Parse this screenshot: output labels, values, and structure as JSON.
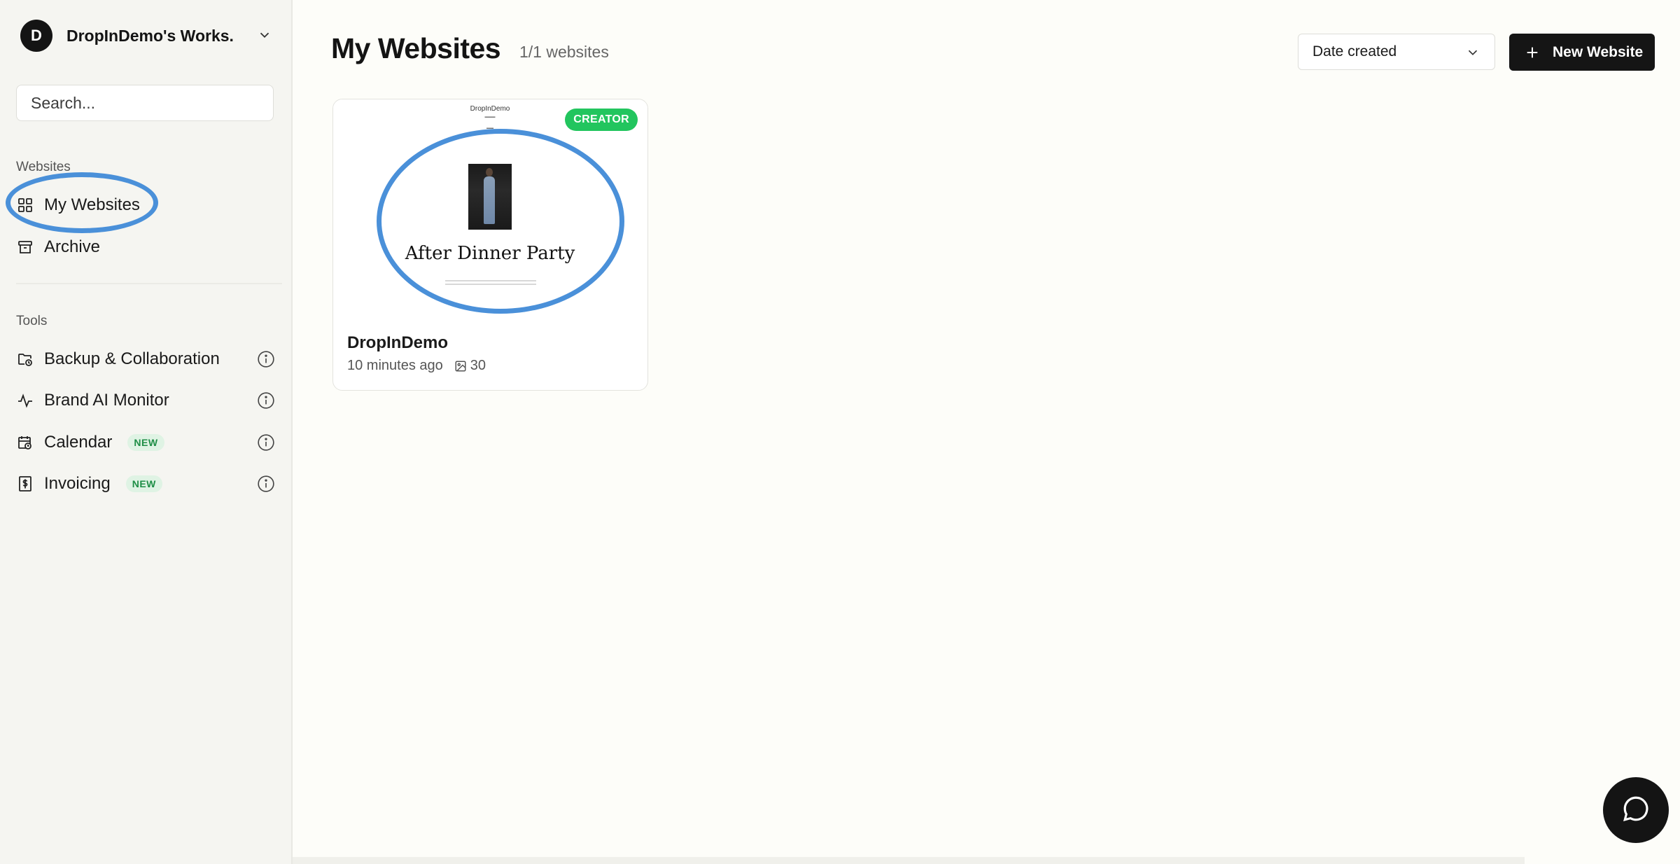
{
  "workspace": {
    "avatar_letter": "D",
    "name": "DropInDemo's Works..."
  },
  "search": {
    "placeholder": "Search..."
  },
  "sidebar": {
    "websites_label": "Websites",
    "websites_items": [
      {
        "label": "My Websites",
        "icon": "grid-icon"
      },
      {
        "label": "Archive",
        "icon": "archive-icon"
      }
    ],
    "tools_label": "Tools",
    "tools_items": [
      {
        "label": "Backup & Collaboration",
        "icon": "folder-sync-icon",
        "badge": ""
      },
      {
        "label": "Brand AI Monitor",
        "icon": "activity-icon",
        "badge": ""
      },
      {
        "label": "Calendar",
        "icon": "calendar-clock-icon",
        "badge": "NEW"
      },
      {
        "label": "Invoicing",
        "icon": "invoice-icon",
        "badge": "NEW"
      }
    ]
  },
  "main": {
    "title": "My Websites",
    "count": "1/1 websites",
    "sort_label": "Date created",
    "new_button": "New Website"
  },
  "card": {
    "thumb_brand": "DropInDemo",
    "thumb_heading": "After Dinner Party",
    "badge": "CREATOR",
    "title": "DropInDemo",
    "time": "10 minutes ago",
    "image_count": "30"
  },
  "colors": {
    "accent_green": "#22c55e",
    "highlight_blue": "#4a90d9",
    "dark": "#141414"
  }
}
